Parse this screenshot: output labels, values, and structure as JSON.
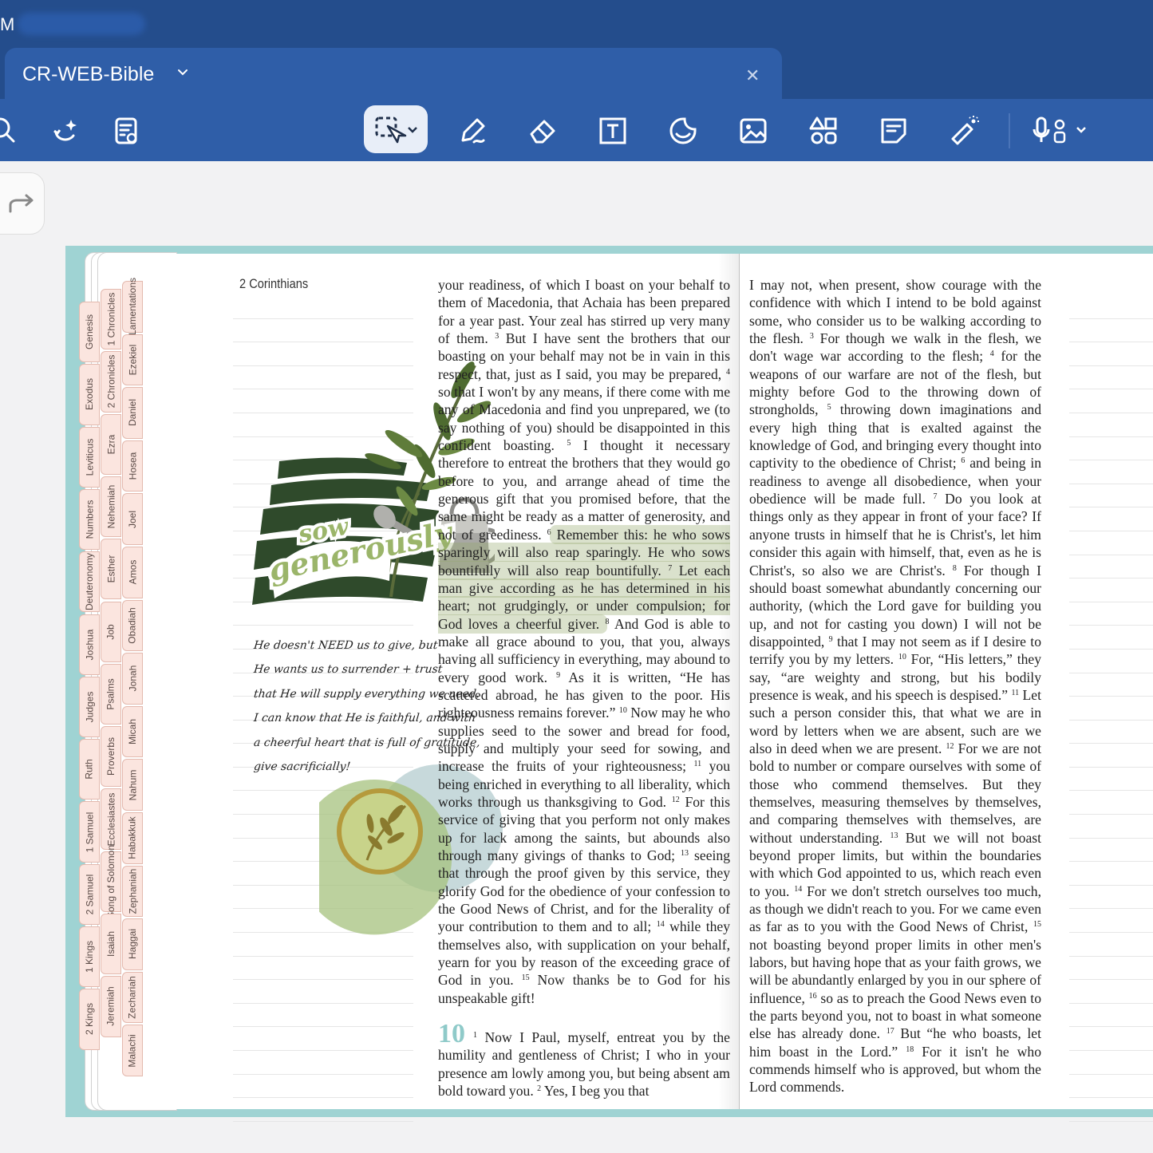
{
  "app": {
    "name": "M"
  },
  "tab": {
    "title": "CR-WEB-Bible"
  },
  "toolbar": {
    "tools": [
      "search-icon",
      "ai-sparkle-icon",
      "page-view-icon",
      "lasso-select-icon",
      "pen-icon",
      "eraser-icon",
      "text-box-icon",
      "sticker-icon",
      "image-icon",
      "shapes-icon",
      "sticky-note-icon",
      "laser-pointer-icon",
      "voice-record-icon"
    ]
  },
  "colors": {
    "chrome": "#2f5ea8",
    "highlight": "#b7c39a",
    "chapter": "#8fcac9",
    "tab_fill": "#fbe5df"
  },
  "left_page": {
    "book_title": "2 Corinthians",
    "tabs_col1": [
      "Genesis",
      "Exodus",
      "Leviticus",
      "Numbers",
      "Deuteronomy",
      "Joshua",
      "Judges",
      "Ruth",
      "1 Samuel",
      "2 Samuel",
      "1 Kings",
      "2 Kings"
    ],
    "tabs_col2": [
      "1 Chronicles",
      "2 Chronicles",
      "Ezra",
      "Nehemiah",
      "Esther",
      "Job",
      "Psalms",
      "Proverbs",
      "Ecclesiastes",
      "Song of Solomon",
      "Isaiah",
      "Jeremiah"
    ],
    "tabs_col3": [
      "Lamentations",
      "Ezekiel",
      "Daniel",
      "Hosea",
      "Joel",
      "Amos",
      "Obadiah",
      "Jonah",
      "Micah",
      "Nahum",
      "Habakkuk",
      "Zephaniah",
      "Haggai",
      "Zechariah",
      "Malachi"
    ],
    "sticker_text": "sow generously",
    "note_lines": [
      "He doesn't NEED us to give, but",
      "He wants us to surrender + trust",
      "that He will supply everything we need.",
      "I can know that He is faithful, and with",
      "a cheerful heart that is full of gratitude,",
      "give sacrificially!"
    ]
  },
  "center_column": {
    "p1_a": "your readiness, of which I boast on your behalf to them of Macedonia, that Achaia has been prepared for a year past. Your zeal has stirred up very many of them. ",
    "v3": "3",
    "p1_b": " But I have sent the brothers that our boasting on your behalf may not be in vain in this respect, that, just as I said, you may be prepared, ",
    "v4": "4",
    "p1_c": " so that I won't by any means, if there come with me any of Macedonia and find you unprepared, we (to say nothing of you) should be disappointed in this confident boasting. ",
    "v5": "5",
    "p1_d": " I thought it necessary therefore to entreat the brothers that they would go before to you, and arrange ahead of time the generous gift that you promised before, that the same might be ready as a matter of generosity, and not of greediness. ",
    "v6": "6",
    "hl_a": " Remember this: he who sows sparingly will also reap sparingly. He who sows bountifully will also reap bountifully. ",
    "v7": "7",
    "hl_b": " Let each man give according as he has determined in his heart; not grudgingly, or under compulsion; for God loves a cheerful giver. ",
    "v8": "8",
    "p1_e": " And God is able to make all grace abound to you, that you, always having all sufficiency in everything, may abound to every good work. ",
    "v9": "9",
    "p1_f": " As it is written, “He has scattered abroad, he has given to the poor. His righteousness remains forever.” ",
    "v10": "10",
    "p1_g": " Now may he who supplies seed to the sower and bread for food, supply and multiply your seed for sowing, and increase the fruits of your righteousness; ",
    "v11": "11",
    "p1_h": " you being enriched in everything to all liberality, which works through us thanksgiving to God. ",
    "v12": "12",
    "p1_i": " For this service of giving that you perform not only makes up for lack among the saints, but abounds also through many givings of thanks to God; ",
    "v13": "13",
    "p1_j": " seeing that through the proof given by this service, they glorify God for the obedience of your confession to the Good News of Christ, and for the liberality of your contribution to them and to all; ",
    "v14": "14",
    "p1_k": " while they themselves also, with supplication on your behalf, yearn for you by reason of the exceeding grace of God in you. ",
    "v15": "15",
    "p1_l": " Now thanks be to God for his unspeakable gift!",
    "chapter": "10",
    "c10v1": "1",
    "p2_a": " Now I Paul, myself, entreat you by the humility and gentleness of Christ; I who in your presence am lowly among you, but being absent am bold toward you. ",
    "c10v2": "2",
    "p2_b": " Yes, I beg you that"
  },
  "right_column": {
    "a": "I may not, when present, show courage with the confidence with which I intend to be bold against some, who consider us to be walking according to the flesh. ",
    "v3": "3",
    "b": " For though we walk in the flesh, we don't wage war according to the flesh; ",
    "v4": "4",
    "c": " for the weapons of our warfare are not of the flesh, but mighty before God to the throwing down of strongholds, ",
    "v5": "5",
    "d": " throwing down imaginations and every high thing that is exalted against the knowledge of God, and bringing every thought into captivity to the obedience of Christ; ",
    "v6": "6",
    "e": " and being in readiness to avenge all disobedience, when your obedience will be made full. ",
    "v7": "7",
    "f": " Do you look at things only as they appear in front of your face? If anyone trusts in himself that he is Christ's, let him consider this again with himself, that, even as he is Christ's, so also we are Christ's. ",
    "v8": "8",
    "g": " For though I should boast somewhat abundantly concerning our authority, (which the Lord gave for building you up, and not for casting you down) I will not be disappointed, ",
    "v9": "9",
    "h": " that I may not seem as if I desire to terrify you by my letters. ",
    "v10": "10",
    "i": " For, “His letters,” they say, “are weighty and strong, but his bodily presence is weak, and his speech is despised.” ",
    "v11": "11",
    "j": " Let such a person consider this, that what we are in word by letters when we are absent, such are we also in deed when we are present. ",
    "v12": "12",
    "k": " For we are not bold to number or compare ourselves with some of those who commend themselves. But they themselves, measuring themselves by themselves, and comparing themselves with themselves, are without understanding. ",
    "v13": "13",
    "l": " But we will not boast beyond proper limits, but within the boundaries with which God appointed to us, which reach even to you. ",
    "v14": "14",
    "m": " For we don't stretch ourselves too much, as though we didn't reach to you. For we came even as far as to you with the Good News of Christ, ",
    "v15": "15",
    "n": " not boasting beyond proper limits in other men's labors, but having hope that as your faith grows, we will be abundantly enlarged by you in our sphere of influence, ",
    "v16": "16",
    "o": " so as to preach the Good News even to the parts beyond you, not to boast in what someone else has already done. ",
    "v17": "17",
    "p": " But “he who boasts, let him boast in the Lord.” ",
    "v18": "18",
    "q": " For it isn't he who commends himself who is approved, but whom the Lord commends."
  }
}
